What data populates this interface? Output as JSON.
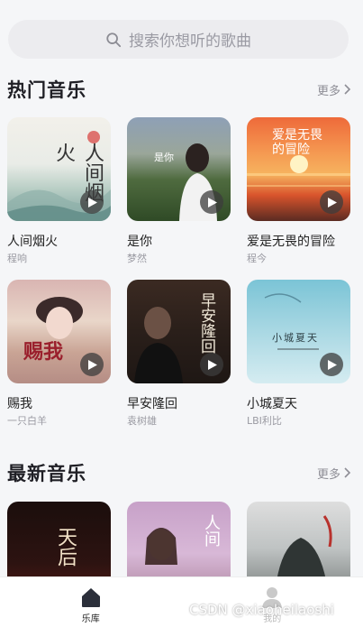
{
  "search": {
    "placeholder": "搜索你想听的歌曲",
    "icon": "search-icon"
  },
  "hot": {
    "title": "热门音乐",
    "more": "更多",
    "songs": [
      {
        "title": "人间烟火",
        "artist": "程响",
        "cover_text": "人间烟火"
      },
      {
        "title": "是你",
        "artist": "梦然",
        "cover_text": "是你"
      },
      {
        "title": "爱是无畏的冒险",
        "artist": "程今",
        "cover_text": "爱是无畏的冒险"
      },
      {
        "title": "赐我",
        "artist": "一只白羊",
        "cover_text": "赐我"
      },
      {
        "title": "早安隆回",
        "artist": "袁树雄",
        "cover_text": "早安隆回"
      },
      {
        "title": "小城夏天",
        "artist": "LBI利比",
        "cover_text": "小城夏天"
      }
    ]
  },
  "latest": {
    "title": "最新音乐",
    "more": "更多",
    "songs": [
      {
        "cover_text": "天后"
      },
      {
        "cover_text": "人间"
      },
      {
        "cover_text": ""
      }
    ]
  },
  "tabbar": {
    "tabs": [
      {
        "label": "乐库",
        "icon": "home-icon",
        "active": true
      },
      {
        "label": "我的",
        "icon": "user-icon",
        "active": false
      }
    ]
  },
  "watermark": "CSDN @xiaoheilaoshi"
}
